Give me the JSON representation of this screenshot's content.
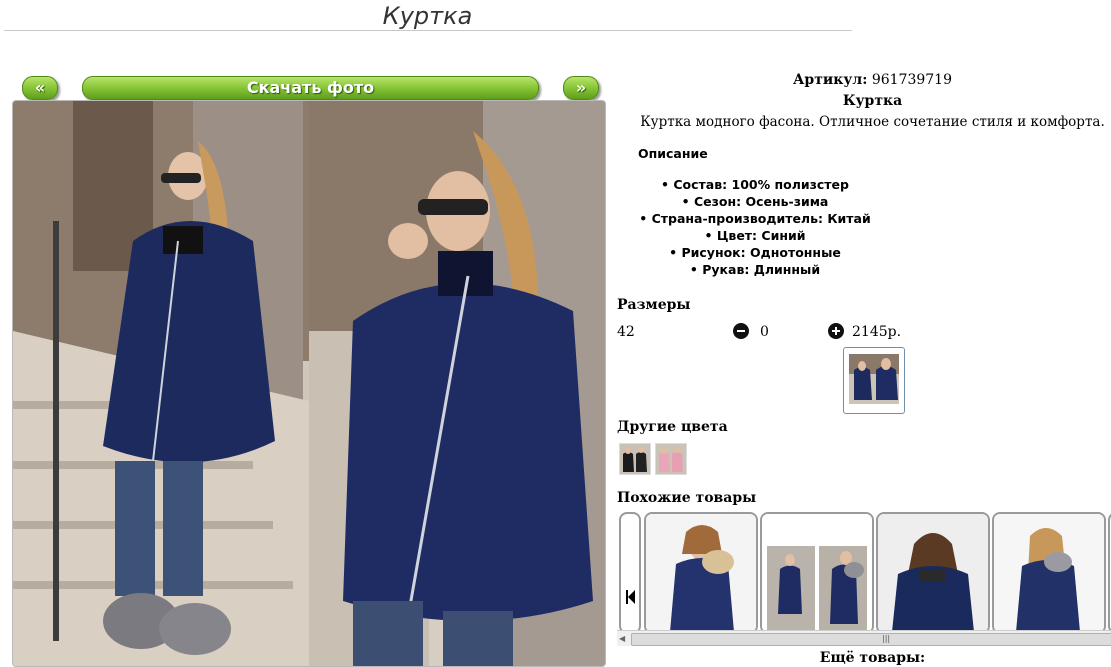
{
  "header": {
    "title": "Куртка"
  },
  "gallery": {
    "prev_label": "«",
    "download_label": "Скачать фото",
    "next_label": "»"
  },
  "product": {
    "sku_label": "Артикул:",
    "sku": "961739719",
    "name": "Куртка",
    "description": "Куртка модного фасона. Отличное сочетание стиля и комфорта.",
    "description_heading": "Описание",
    "properties": [
      "• Состав: 100% полизстер",
      "• Сезон: Осень-зима",
      "• Страна-производитель: Китай",
      "• Цвет: Синий",
      "• Рисунок: Однотонные",
      "• Рукав: Длинный"
    ]
  },
  "sizes": {
    "heading": "Размеры",
    "size": "42",
    "quantity": "0",
    "price": "2145р."
  },
  "colors": {
    "heading": "Другие цвета"
  },
  "similar": {
    "heading": "Похожие товары"
  },
  "more": {
    "heading": "Ещё товары:"
  },
  "icons": {
    "minus": "minus-circle-icon",
    "plus": "plus-circle-icon",
    "carousel_left": "skip-back-icon",
    "scroll_left": "scroll-left-arrow-icon"
  },
  "colors_palette": {
    "accent_green": "#8bc83a",
    "jacket_navy": "#1d2a5e",
    "frame_border": "#9a9a9a"
  }
}
